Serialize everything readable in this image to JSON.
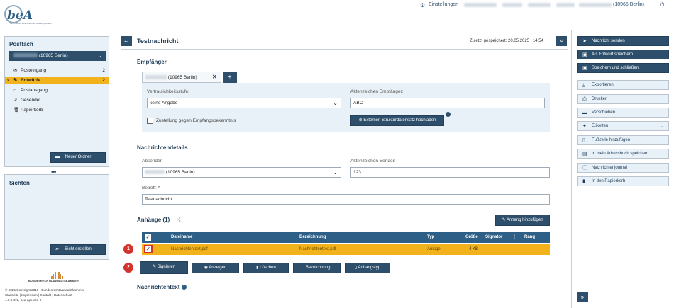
{
  "app": {
    "logo_text": "beA",
    "logo_sub": "Besonderes elektronisches Anwaltspostfach"
  },
  "topbar": {
    "settings_label": "Einstellungen",
    "user_label": "(10965 Berlin)"
  },
  "postfach": {
    "title": "Postfach",
    "account": "(10965 Berlin)",
    "folders": [
      {
        "label": "Posteingang",
        "count": "2",
        "icon": "inbox-icon"
      },
      {
        "label": "Entwürfe",
        "count": "2",
        "icon": "draft-icon"
      },
      {
        "label": "Postausgang",
        "count": "",
        "icon": "outbox-icon"
      },
      {
        "label": "Gesendet",
        "count": "",
        "icon": "sent-icon"
      },
      {
        "label": "Papierkorb",
        "count": "",
        "icon": "trash-icon"
      }
    ],
    "new_folder_button": "Neuer Ordner"
  },
  "sichten": {
    "title": "Sichten",
    "create_button": "Sicht erstellen"
  },
  "footer": {
    "org": "BUNDESRECHTSANWALTSKAMMER",
    "copyright": "© 2025 Copyright 2018 - Bundesrechtsanwaltskammer",
    "links": "Startseite | Impressum | Kontakt | Datenschutz",
    "version": "4.0.2.472, bea-app-cc1-2"
  },
  "message": {
    "title": "Testnachricht",
    "saved": "Zuletzt gespeichert: 20.05.2025 | 14:54"
  },
  "recipients": {
    "heading": "Empfänger",
    "tag": "(10965 Berlin)",
    "add_button": "+",
    "confidentiality_label": "Vertraulichkeitsstufe:",
    "confidentiality_value": "keine Angabe",
    "ref_label": "Aktenzeichen Empfänger:",
    "ref_value": "ABC",
    "receipt_label": "Zustellung gegen Empfangsbekenntnis",
    "upload_button": "Externen Strukturdatensatz hochladen"
  },
  "details": {
    "heading": "Nachrichtendetails",
    "sender_label": "Absender:",
    "sender_value": "(10965 Berlin)",
    "sender_ref_label": "Aktenzeichen Sender:",
    "sender_ref_value": "123",
    "subject_label": "Betreff: *",
    "subject_value": "Testnachricht"
  },
  "attachments": {
    "heading": "Anhänge (1)",
    "add_button": "Anhang hinzufügen",
    "columns": {
      "filename": "Dateiname",
      "designation": "Bezeichnung",
      "type": "Typ",
      "size": "Größe",
      "signer": "Signator",
      "rank": "Rang"
    },
    "rows": [
      {
        "filename": "Nachrichtentext.pdf",
        "designation": "Nachrichtentext.pdf",
        "type": "Anlage",
        "size": "4 KB",
        "signer": "",
        "rank": ""
      }
    ],
    "actions": {
      "sign": "Signieren",
      "view": "Anzeigen",
      "delete": "Löschen",
      "designation": "Bezeichnung",
      "type": "Anhangstyp"
    }
  },
  "message_text": {
    "heading": "Nachrichtentext"
  },
  "step_badges": [
    "1",
    "2"
  ],
  "sidebar_right": {
    "primary": [
      {
        "label": "Nachricht senden",
        "icon": "send-icon"
      },
      {
        "label": "Als Entwurf speichern",
        "icon": "save-icon"
      },
      {
        "label": "Speichern und schließen",
        "icon": "save-close-icon"
      }
    ],
    "secondary": [
      {
        "label": "Exportieren",
        "icon": "download-icon"
      },
      {
        "label": "Drucken",
        "icon": "print-icon"
      },
      {
        "label": "Verschieben",
        "icon": "folder-icon"
      },
      {
        "label": "Etiketten",
        "icon": "tag-icon"
      },
      {
        "label": "Fußzeile hinzufügen",
        "icon": "file-icon"
      },
      {
        "label": "In mein Adressbuch speichern",
        "icon": "address-book-icon"
      },
      {
        "label": "Nachrichtenjournal",
        "icon": "info-icon"
      },
      {
        "label": "In den Papierkorb",
        "icon": "trash-icon"
      }
    ]
  },
  "colors": {
    "accent": "#2e4f6b",
    "highlight": "#f1b21b",
    "alert": "#d2332d",
    "panel": "#e8f1f8"
  }
}
